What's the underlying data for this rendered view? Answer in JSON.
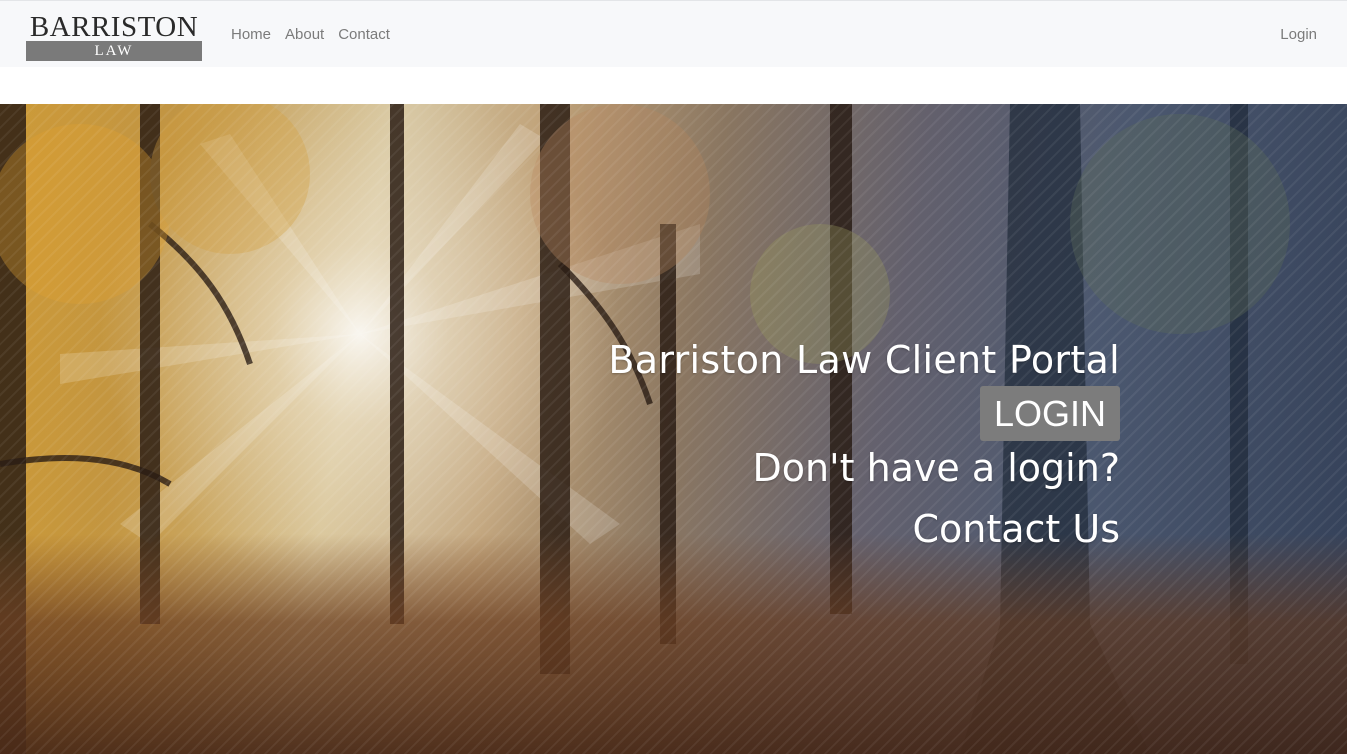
{
  "brand": {
    "name": "BARRISTON",
    "sub": "LAW"
  },
  "nav": {
    "links": [
      "Home",
      "About",
      "Contact"
    ],
    "login": "Login"
  },
  "hero": {
    "title": "Barriston Law Client Portal",
    "login_button": "LOGIN",
    "no_login_text": "Don't have a login?",
    "contact_link": "Contact Us"
  }
}
